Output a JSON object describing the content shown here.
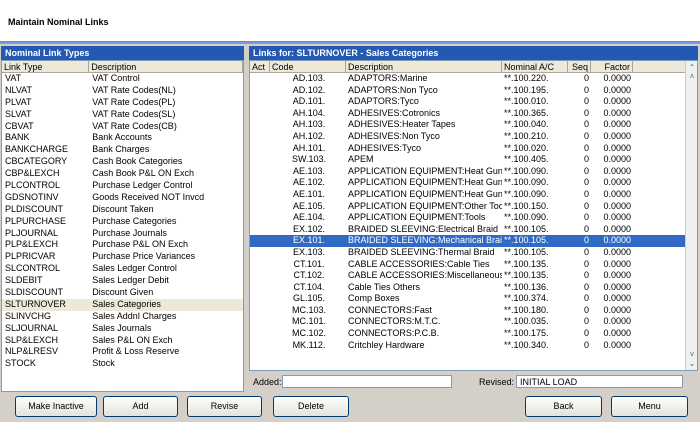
{
  "window": {
    "title": "Maintain Nominal Links"
  },
  "left_panel": {
    "title": "Nominal Link Types",
    "columns": [
      "Link Type",
      "Description"
    ],
    "rows": [
      [
        "VAT",
        "VAT Control"
      ],
      [
        "NLVAT",
        "VAT Rate Codes(NL)"
      ],
      [
        "PLVAT",
        "VAT Rate Codes(PL)"
      ],
      [
        "SLVAT",
        "VAT Rate Codes(SL)"
      ],
      [
        "CBVAT",
        "VAT Rate Codes(CB)"
      ],
      [
        "BANK",
        "Bank Accounts"
      ],
      [
        "BANKCHARGE",
        "Bank Charges"
      ],
      [
        "CBCATEGORY",
        "Cash Book Categories"
      ],
      [
        "CBP&LEXCH",
        "Cash Book P&L ON Exch"
      ],
      [
        "PLCONTROL",
        "Purchase Ledger Control"
      ],
      [
        "GDSNOTINV",
        "Goods Received NOT Invcd"
      ],
      [
        "PLDISCOUNT",
        "Discount Taken"
      ],
      [
        "PLPURCHASE",
        "Purchase Categories"
      ],
      [
        "PLJOURNAL",
        "Purchase Journals"
      ],
      [
        "PLP&LEXCH",
        "Purchase P&L ON Exch"
      ],
      [
        "PLPRICVAR",
        "Purchase Price Variances"
      ],
      [
        "SLCONTROL",
        "Sales Ledger Control"
      ],
      [
        "SLDEBIT",
        "Sales Ledger Debit"
      ],
      [
        "SLDISCOUNT",
        "Discount Given"
      ],
      [
        "SLTURNOVER",
        "Sales Categories"
      ],
      [
        "SLINVCHG",
        "Sales Addnl Charges"
      ],
      [
        "SLJOURNAL",
        "Sales Journals"
      ],
      [
        "SLP&LEXCH",
        "Sales P&L ON Exch"
      ],
      [
        "NLP&LRESV",
        "Profit & Loss Reserve"
      ],
      [
        "STOCK",
        "Stock"
      ]
    ],
    "selected_index": 19
  },
  "right_panel": {
    "title": "Links for: SLTURNOVER - Sales Categories",
    "columns": [
      "Act",
      "Code",
      "Description",
      "Nominal A/C",
      "Seq",
      "Factor"
    ],
    "rows": [
      [
        "",
        "AD.103.",
        "ADAPTORS:Marine",
        "**.100.220.",
        "0",
        "0.0000"
      ],
      [
        "",
        "AD.102.",
        "ADAPTORS:Non Tyco",
        "**.100.195.",
        "0",
        "0.0000"
      ],
      [
        "",
        "AD.101.",
        "ADAPTORS:Tyco",
        "**.100.010.",
        "0",
        "0.0000"
      ],
      [
        "",
        "AH.104.",
        "ADHESIVES:Cotronics",
        "**.100.365.",
        "0",
        "0.0000"
      ],
      [
        "",
        "AH.103.",
        "ADHESIVES:Heater Tapes",
        "**.100.040.",
        "0",
        "0.0000"
      ],
      [
        "",
        "AH.102.",
        "ADHESIVES:Non Tyco",
        "**.100.210.",
        "0",
        "0.0000"
      ],
      [
        "",
        "AH.101.",
        "ADHESIVES:Tyco",
        "**.100.020.",
        "0",
        "0.0000"
      ],
      [
        "",
        "SW.103.",
        "APEM",
        "**.100.405.",
        "0",
        "0.0000"
      ],
      [
        "",
        "AE.103.",
        "APPLICATION EQUIPMENT:Heat Gun",
        "**.100.090.",
        "0",
        "0.0000"
      ],
      [
        "",
        "AE.102.",
        "APPLICATION EQUIPMENT:Heat Gun",
        "**.100.090.",
        "0",
        "0.0000"
      ],
      [
        "",
        "AE.101.",
        "APPLICATION EQUIPMENT:Heat Guns",
        "**.100.090.",
        "0",
        "0.0000"
      ],
      [
        "",
        "AE.105.",
        "APPLICATION EQUIPMENT:Other Tools",
        "**.100.150.",
        "0",
        "0.0000"
      ],
      [
        "",
        "AE.104.",
        "APPLICATION EQUIPMENT:Tools",
        "**.100.090.",
        "0",
        "0.0000"
      ],
      [
        "",
        "EX.102.",
        "BRAIDED SLEEVING:Electrical Braid",
        "**.100.105.",
        "0",
        "0.0000"
      ],
      [
        "",
        "EX.101.",
        "BRAIDED SLEEVING:Mechanical Braid",
        "**.100.105.",
        "0",
        "0.0000"
      ],
      [
        "",
        "EX.103.",
        "BRAIDED SLEEVING:Thermal Braid",
        "**.100.105.",
        "0",
        "0.0000"
      ],
      [
        "",
        "CT.101.",
        "CABLE ACCESSORIES:Cable Ties",
        "**.100.135.",
        "0",
        "0.0000"
      ],
      [
        "",
        "CT.102.",
        "CABLE ACCESSORIES:Miscellaneous",
        "**.100.135.",
        "0",
        "0.0000"
      ],
      [
        "",
        "CT.104.",
        "Cable Ties Others",
        "**.100.136.",
        "0",
        "0.0000"
      ],
      [
        "",
        "GL.105.",
        "Comp Boxes",
        "**.100.374.",
        "0",
        "0.0000"
      ],
      [
        "",
        "MC.103.",
        "CONNECTORS:Fast",
        "**.100.180.",
        "0",
        "0.0000"
      ],
      [
        "",
        "MC.101.",
        "CONNECTORS:M.T.C.",
        "**.100.035.",
        "0",
        "0.0000"
      ],
      [
        "",
        "MC.102.",
        "CONNECTORS:P.C.B.",
        "**.100.175.",
        "0",
        "0.0000"
      ],
      [
        "",
        "MK.112.",
        "Critchley Hardware",
        "**.100.340.",
        "0",
        "0.0000"
      ]
    ],
    "selected_index": 14
  },
  "footer": {
    "added_label": "Added:",
    "added_value": "",
    "revised_label": "Revised:",
    "revised_value": "INITIAL LOAD"
  },
  "buttons": {
    "make_inactive": "Make Inactive",
    "add": "Add",
    "revise": "Revise",
    "delete": "Delete",
    "back": "Back",
    "menu": "Menu"
  },
  "colors": {
    "selection": "#316ac5",
    "panel_title": "#2459b3"
  }
}
